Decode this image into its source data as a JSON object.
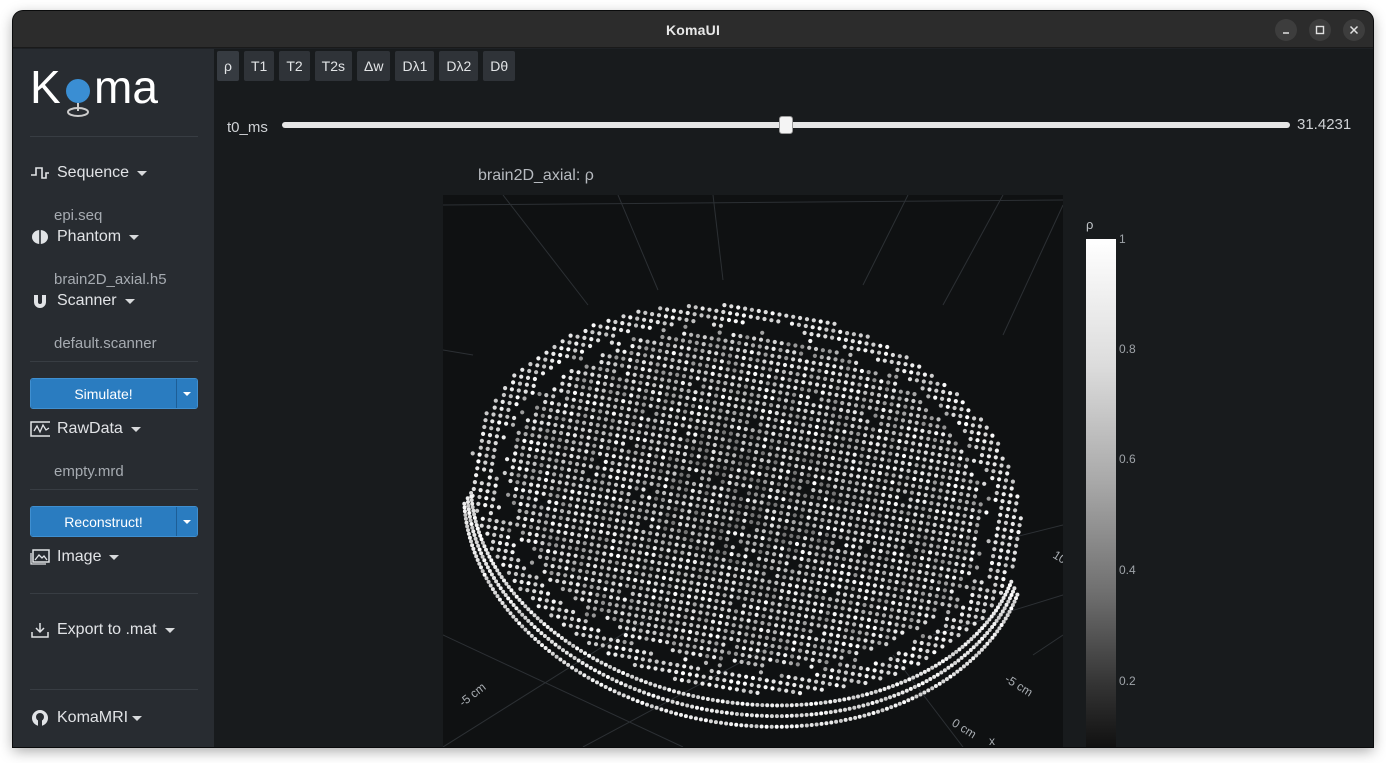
{
  "window": {
    "title": "KomaUI",
    "minimize_label": "–",
    "maximize_label": "□",
    "close_label": "✕"
  },
  "sidebar": {
    "logo_text": "Koma",
    "sequence": {
      "label": "Sequence",
      "file": "epi.seq",
      "icon": "sequence-pulse-icon"
    },
    "phantom": {
      "label": "Phantom",
      "file": "brain2D_axial.h5",
      "icon": "brain-icon"
    },
    "scanner": {
      "label": "Scanner",
      "file": "default.scanner",
      "icon": "magnet-icon"
    },
    "simulate": {
      "label": "Simulate!"
    },
    "rawdata": {
      "label": "RawData",
      "file": "empty.mrd",
      "icon": "signal-icon"
    },
    "reconstruct": {
      "label": "Reconstruct!"
    },
    "image": {
      "label": "Image",
      "icon": "image-icon"
    },
    "export": {
      "label": "Export to .mat",
      "icon": "download-icon"
    },
    "github": {
      "label": "KomaMRI",
      "icon": "github-icon"
    }
  },
  "tabs": [
    "ρ",
    "T1",
    "T2",
    "T2s",
    "Δw",
    "Dλ1",
    "Dλ2",
    "Dθ"
  ],
  "active_tab": "ρ",
  "slider": {
    "label": "t0_ms",
    "value": "31.4231",
    "position_fraction": 0.5
  },
  "plot": {
    "title": "brain2D_axial: ρ",
    "axis_labels": {
      "a": "-5 cm",
      "b": "-5 cm",
      "c": "0 cm",
      "d": "10",
      "e": "x"
    }
  },
  "colorbar": {
    "title": "ρ",
    "ticks": [
      "1",
      "0.8",
      "0.6",
      "0.4",
      "0.2"
    ]
  },
  "colors": {
    "accent": "#2a7cc0",
    "sidebar_bg": "#282c31",
    "main_bg": "#181b1d",
    "titlebar_bg": "#2c2c2c"
  }
}
